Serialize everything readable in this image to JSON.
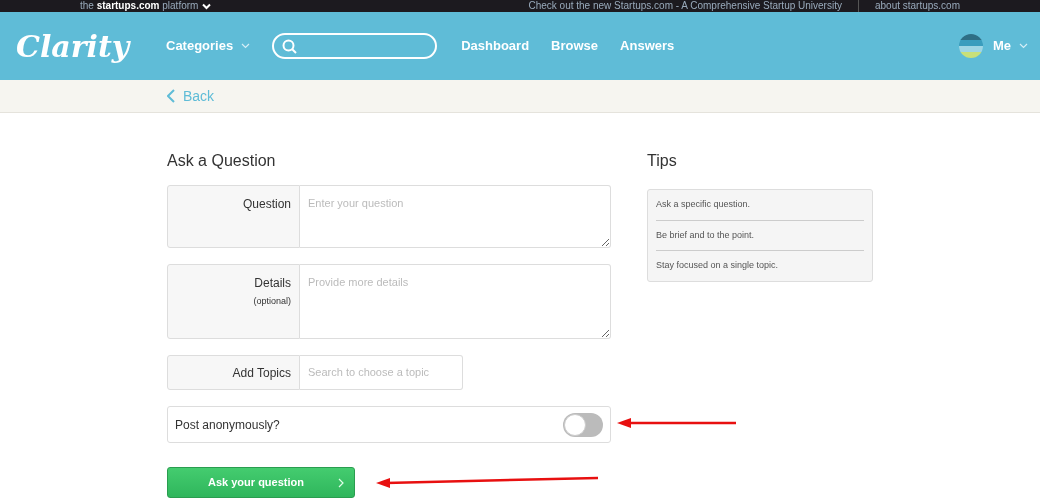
{
  "topbar": {
    "platform": "the **startups.com** platform",
    "promo": "Check out the new Startups.com - A Comprehensive Startup University",
    "about": "about startups.com"
  },
  "header": {
    "logo": "Clarity",
    "nav": [
      {
        "label": "Categories",
        "dropdown": true
      },
      {
        "label": "Dashboard",
        "dropdown": false
      },
      {
        "label": "Browse",
        "dropdown": false
      },
      {
        "label": "Answers",
        "dropdown": false
      }
    ],
    "user": "Me"
  },
  "back": "Back",
  "form": {
    "title": "Ask a Question",
    "fields": [
      {
        "kind": "textarea",
        "label": "Question",
        "placeholder": "Enter your question"
      },
      {
        "kind": "textarea",
        "label": "Details",
        "sublabel": "(optional)",
        "placeholder": "Provide more details"
      },
      {
        "kind": "input",
        "label": "Add Topics",
        "placeholder": "Search to choose a topic"
      }
    ],
    "anonymous": {
      "label": "Post anonymously?",
      "on": false
    },
    "submit": "Ask your question"
  },
  "tips": {
    "title": "Tips",
    "items": [
      "Ask a specific question.",
      "Be brief and to the point.",
      "Stay focused on a single topic."
    ]
  }
}
